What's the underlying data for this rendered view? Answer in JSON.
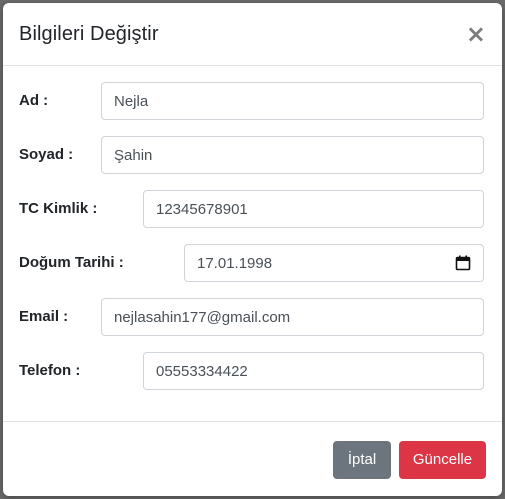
{
  "modal": {
    "title": "Bilgileri Değiştir",
    "close_symbol": "×"
  },
  "form": {
    "fields": [
      {
        "label": "Ad :",
        "value": "Nejla"
      },
      {
        "label": "Soyad :",
        "value": "Şahin"
      },
      {
        "label": "TC Kimlik :",
        "value": "12345678901"
      },
      {
        "label": "Doğum Tarihi :",
        "value": "17.01.1998",
        "icon": "calendar-icon"
      },
      {
        "label": "Email :",
        "value": "nejlasahin177@gmail.com"
      },
      {
        "label": "Telefon :",
        "value": "05553334422"
      }
    ]
  },
  "footer": {
    "cancel_label": "İptal",
    "update_label": "Güncelle"
  },
  "colors": {
    "cancel": "#6c757d",
    "update": "#dc3545"
  }
}
